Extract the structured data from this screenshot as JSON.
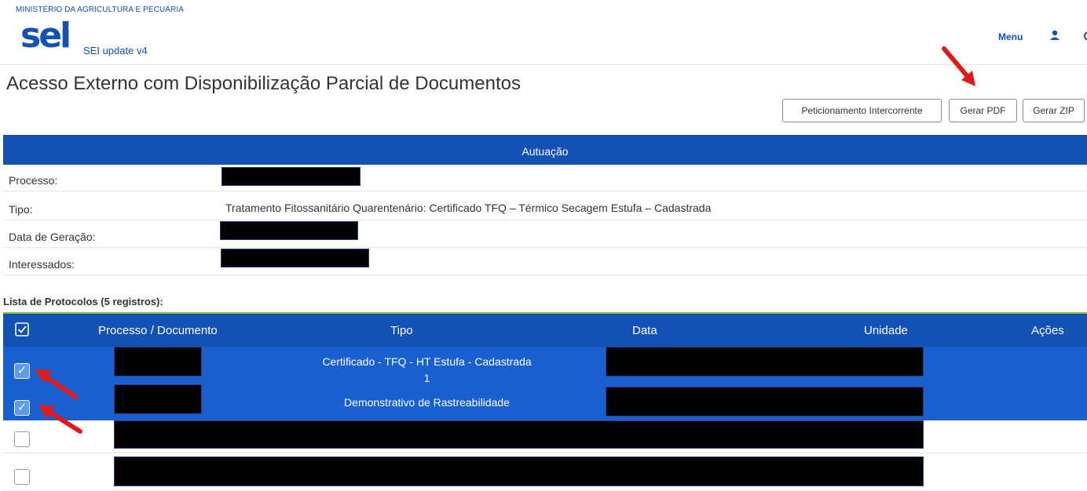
{
  "header": {
    "ministry": "MINISTÉRIO DA AGRICULTURA E PECUÁRIA",
    "logo": "sei",
    "subtitle": "SEI update v4",
    "menu_label": "Menu",
    "user_icon": "user-icon",
    "partial_icon": "gear-icon"
  },
  "page_title": "Acesso Externo com Disponibilização Parcial de Documentos",
  "toolbar": {
    "peticionamento_label": "Peticionamento Intercorrente",
    "gerar_pdf_label": "Gerar PDF",
    "gerar_zip_label": "Gerar ZIP"
  },
  "autuacao": {
    "title": "Autuação",
    "rows": [
      {
        "label": "Processo:",
        "value": ""
      },
      {
        "label": "Tipo:",
        "value": "Tratamento Fitossanitário Quarentenário: Certificado TFQ – Térmico Secagem Estufa – Cadastrada"
      },
      {
        "label": "Data de Geração:",
        "value": ""
      },
      {
        "label": "Interessados:",
        "value": ""
      }
    ]
  },
  "protocol_list": {
    "title": "Lista de Protocolos (5 registros):",
    "columns": [
      "Processo / Documento",
      "Tipo",
      "Data",
      "Unidade",
      "Ações"
    ],
    "rows": [
      {
        "selected": true,
        "tipo_line1": "Certificado - TFQ - HT Estufa - Cadastrada",
        "tipo_line2": "1"
      },
      {
        "selected": true,
        "tipo_line1": "Demonstrativo de Rastreabilidade",
        "tipo_line2": ""
      },
      {
        "selected": false,
        "tipo_line1": "",
        "tipo_line2": ""
      },
      {
        "selected": false,
        "tipo_line1": "",
        "tipo_line2": ""
      }
    ]
  },
  "colors": {
    "primary": "#1351b4",
    "selected_row": "#1a5fcf",
    "accent_line": "#8cc63f",
    "annotation_arrow": "#e01a1a"
  }
}
